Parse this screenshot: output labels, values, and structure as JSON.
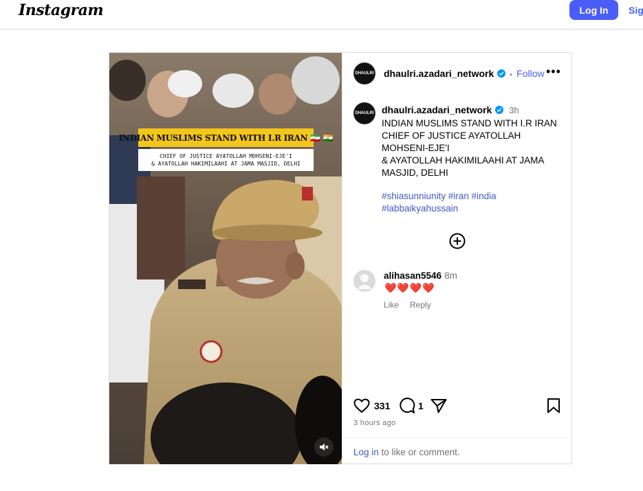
{
  "header": {
    "logo": "Instagram",
    "login_label": "Log In",
    "signup_label": "Sign Up"
  },
  "post": {
    "media": {
      "overlay_title": "INDIAN MUSLIMS STAND WITH I.R IRAN 🇮🇷 🇮🇳",
      "overlay_subtitle_line1": "CHIEF OF JUSTICE AYATOLLAH MOHSENI-EJE'I",
      "overlay_subtitle_line2": "& AYATOLLAH HAKIMILAAHI AT JAMA MASJID, DELHI",
      "avatar_text": "DHAULRI"
    },
    "author": {
      "username": "dhaulri.azadari_network",
      "follow_label": "Follow",
      "separator": "•",
      "more": "•••"
    },
    "caption": {
      "username": "dhaulri.azadari_network",
      "time": "3h",
      "text": "INDIAN MUSLIMS STAND WITH I.R IRAN\nCHIEF OF JUSTICE AYATOLLAH MOHSENI-EJE'I\n& AYATOLLAH HAKIMILAAHI AT JAMA MASJID, DELHI",
      "hashtags": [
        "#shiasunniunity",
        "#iran",
        "#india",
        "#labbaikyahussain"
      ]
    },
    "comments": [
      {
        "username": "alihasan5546",
        "time": "8m",
        "text": "❤️❤️❤️❤️",
        "like_label": "Like",
        "reply_label": "Reply"
      }
    ],
    "stats": {
      "likes": "331",
      "comments": "1"
    },
    "timestamp": "3 hours ago",
    "login_prompt": {
      "link": "Log in",
      "rest": " to like or comment."
    }
  },
  "icons": {
    "verified": "verified-badge-icon",
    "more": "more-options-icon",
    "load_more": "plus-circle-icon",
    "like": "heart-icon",
    "comment": "comment-bubble-icon",
    "share": "paper-plane-icon",
    "save": "bookmark-icon",
    "mute": "speaker-muted-icon",
    "default_avatar": "user-silhouette-icon"
  },
  "colors": {
    "accent": "#4a5df9",
    "link": "#3e5ac4",
    "overlay_title_bg": "#f4c61b",
    "muted": "#737373"
  }
}
